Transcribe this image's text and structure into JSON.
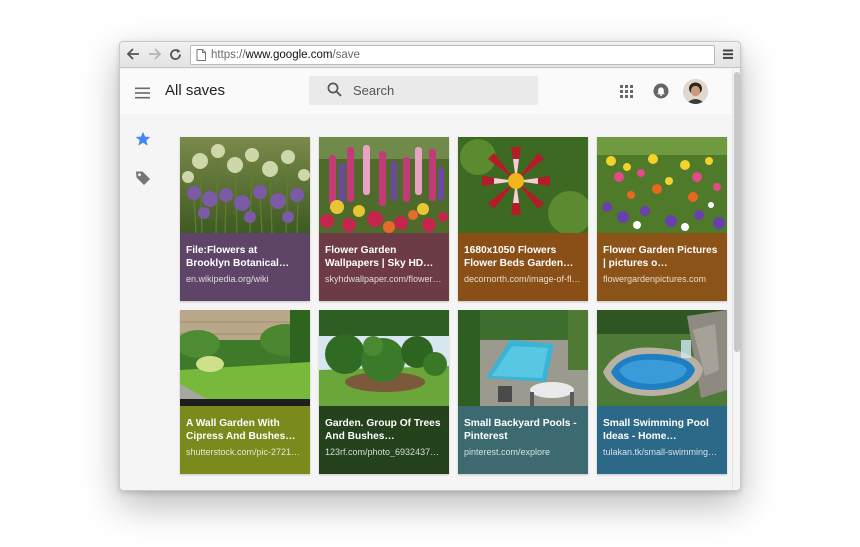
{
  "browser": {
    "url_scheme": "https://",
    "url_host": "www.google.com",
    "url_path": "/save"
  },
  "header": {
    "title": "All saves",
    "search_placeholder": "Search"
  },
  "icons": {
    "menu": "hamburger-icon",
    "search": "search-icon",
    "apps": "apps-grid-icon",
    "notifications": "bell-icon",
    "saved": "star-icon",
    "tags": "tag-icon"
  },
  "colors": {
    "accent_star": "#4285f4"
  },
  "cards": [
    {
      "title": "File:Flowers at Brooklyn Botanical…",
      "source": "en.wikipedia.org/wiki",
      "color": "#5e4568"
    },
    {
      "title": "Flower Garden Wallpapers | Sky HD…",
      "source": "skyhdwallpaper.com/flower…",
      "color": "#6d3b45"
    },
    {
      "title": "1680x1050 Flowers Flower Beds Garden…",
      "source": "decornorth.com/image-of-fl…",
      "color": "#8a4f17"
    },
    {
      "title": "Flower Garden Pictures | pictures o…",
      "source": "flowergardenpictures.com",
      "color": "#8b5317"
    },
    {
      "title": "A Wall Garden With Cipress And Bushes…",
      "source": "shutterstock.com/pic-2721…",
      "color": "#7c8a1d"
    },
    {
      "title": "Garden. Group Of Trees And Bushes…",
      "source": "123rf.com/photo_6932437…",
      "color": "#24421c"
    },
    {
      "title": "Small Backyard Pools - Pinterest",
      "source": "pinterest.com/explore",
      "color": "#3d6a70"
    },
    {
      "title": "Small Swimming Pool Ideas - Home…",
      "source": "tulakan.tk/small-swimming…",
      "color": "#2c6887"
    }
  ]
}
